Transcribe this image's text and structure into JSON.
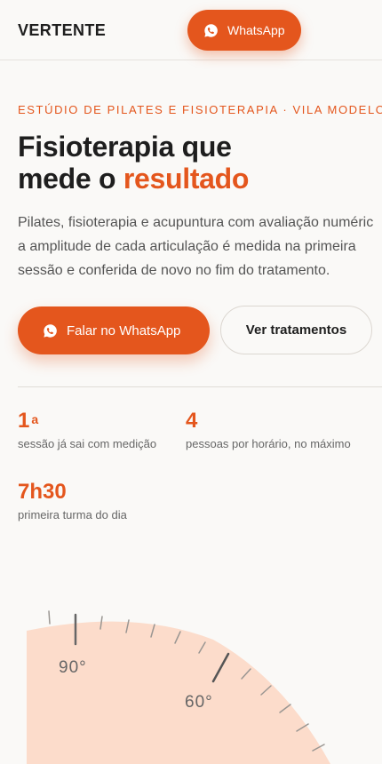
{
  "header": {
    "logo": "VERTENTE",
    "whatsapp_label": "WhatsApp"
  },
  "hero": {
    "eyebrow": "ESTÚDIO DE PILATES E FISIOTERAPIA · VILA MODELO",
    "title_line1": "Fisioterapia que",
    "title_line2_prefix": "mede o ",
    "title_line2_accent": "resultado",
    "description_lines": [
      "Pilates, fisioterapia e acupuntura com avaliação numéric",
      "a amplitude de cada articulação é medida na primeira",
      "sessão e conferida de novo no fim do tratamento."
    ],
    "cta_primary": "Falar no WhatsApp",
    "cta_secondary": "Ver tratamentos"
  },
  "stats": [
    {
      "value": "1",
      "sup": "a",
      "label": "sessão já sai com medição"
    },
    {
      "value": "4",
      "label": "pessoas por horário, no máximo"
    },
    {
      "value": "7h30",
      "label": "primeira turma do dia"
    }
  ],
  "gauge": {
    "labels": [
      "90°",
      "60°"
    ]
  },
  "colors": {
    "accent": "#E4561D",
    "gauge_fill": "#FCDCCB",
    "background": "#FAF9F7"
  }
}
